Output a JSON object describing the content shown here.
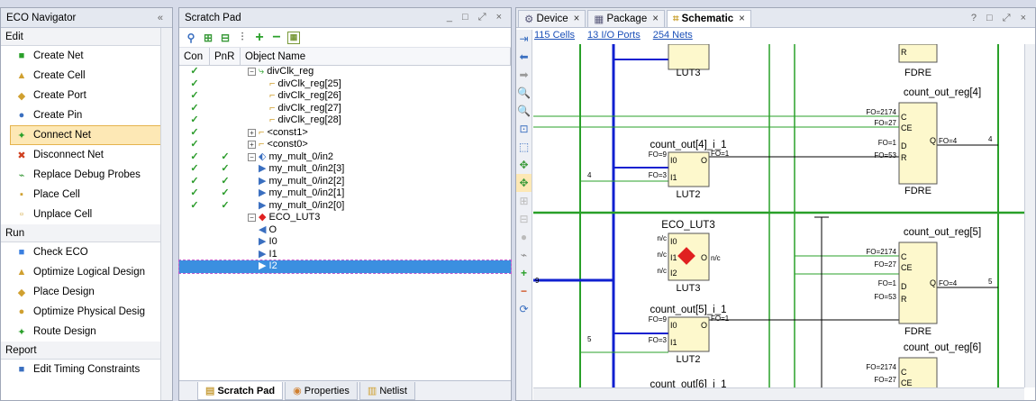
{
  "eco": {
    "title": "ECO Navigator",
    "collapse": "«",
    "sections": {
      "edit": "Edit",
      "run": "Run",
      "report": "Report"
    },
    "edit_items": [
      "Create Net",
      "Create Cell",
      "Create Port",
      "Create Pin",
      "Connect Net",
      "Disconnect Net",
      "Replace Debug Probes",
      "Place Cell",
      "Unplace Cell"
    ],
    "run_items": [
      "Check ECO",
      "Optimize Logical Design",
      "Place Design",
      "Optimize Physical Desig",
      "Route Design"
    ],
    "report_items": [
      "Edit Timing Constraints"
    ]
  },
  "scratchpad": {
    "title": "Scratch Pad",
    "controls": "_ □ ⤢ ×",
    "headers": {
      "con": "Con",
      "pnr": "PnR",
      "name": "Object Name"
    },
    "rows": [
      {
        "con": "✓",
        "pnr": "",
        "name": "divClk_reg",
        "indent": 0,
        "exp": "−",
        "icon": "cell"
      },
      {
        "con": "✓",
        "pnr": "",
        "name": "divClk_reg[25]",
        "indent": 2,
        "exp": "",
        "icon": "pin"
      },
      {
        "con": "✓",
        "pnr": "",
        "name": "divClk_reg[26]",
        "indent": 2,
        "exp": "",
        "icon": "pin"
      },
      {
        "con": "✓",
        "pnr": "",
        "name": "divClk_reg[27]",
        "indent": 2,
        "exp": "",
        "icon": "pin"
      },
      {
        "con": "✓",
        "pnr": "",
        "name": "divClk_reg[28]",
        "indent": 2,
        "exp": "",
        "icon": "pin"
      },
      {
        "con": "✓",
        "pnr": "",
        "name": "<const1>",
        "indent": 0,
        "exp": "+",
        "icon": "pin"
      },
      {
        "con": "✓",
        "pnr": "",
        "name": "<const0>",
        "indent": 0,
        "exp": "+",
        "icon": "pin"
      },
      {
        "con": "✓",
        "pnr": "✓",
        "name": "my_mult_0/in2",
        "indent": 0,
        "exp": "−",
        "icon": "bus"
      },
      {
        "con": "✓",
        "pnr": "✓",
        "name": "my_mult_0/in2[3]",
        "indent": 1,
        "exp": "",
        "icon": "port"
      },
      {
        "con": "✓",
        "pnr": "✓",
        "name": "my_mult_0/in2[2]",
        "indent": 1,
        "exp": "",
        "icon": "port"
      },
      {
        "con": "✓",
        "pnr": "✓",
        "name": "my_mult_0/in2[1]",
        "indent": 1,
        "exp": "",
        "icon": "port"
      },
      {
        "con": "✓",
        "pnr": "✓",
        "name": "my_mult_0/in2[0]",
        "indent": 1,
        "exp": "",
        "icon": "port"
      },
      {
        "con": "",
        "pnr": "",
        "name": "ECO_LUT3",
        "indent": 0,
        "exp": "−",
        "icon": "diamond"
      },
      {
        "con": "",
        "pnr": "",
        "name": "O",
        "indent": 1,
        "exp": "",
        "icon": "outport"
      },
      {
        "con": "",
        "pnr": "",
        "name": "I0",
        "indent": 1,
        "exp": "",
        "icon": "port"
      },
      {
        "con": "",
        "pnr": "",
        "name": "I1",
        "indent": 1,
        "exp": "",
        "icon": "port"
      },
      {
        "con": "",
        "pnr": "",
        "name": "I2",
        "indent": 1,
        "exp": "",
        "icon": "port",
        "selected": true
      }
    ],
    "tabs": [
      "Scratch Pad",
      "Properties",
      "Netlist"
    ]
  },
  "schematic": {
    "tabs": [
      "Device",
      "Package",
      "Schematic"
    ],
    "controls": "? □ ⤢ ×",
    "stats": [
      "115 Cells",
      "13 I/O Ports",
      "254 Nets"
    ],
    "labels": {
      "lut3_top": "LUT3",
      "fdre": "FDRE",
      "reg4": "count_out_reg[4]",
      "reg5": "count_out_reg[5]",
      "reg6": "count_out_reg[6]",
      "i1_4": "count_out[4]_i_1",
      "i1_5": "count_out[5]_i_1",
      "i1_6": "count_out[6]_i_1",
      "lut2": "LUT2",
      "eco": "ECO_LUT3",
      "fo2174": "FO=2174",
      "fo27": "FO=27",
      "fo1": "FO=1",
      "fo53": "FO=53",
      "fo4": "FO=4",
      "fo9": "FO=9",
      "fo3": "FO=3",
      "nc": "n/c",
      "four": "4",
      "five": "5",
      "nine": "9",
      "pC": "C",
      "pCE": "CE",
      "pD": "D",
      "pR": "R",
      "pQ": "Q",
      "pO": "O",
      "pI0": "I0",
      "pI1": "I1",
      "pI2": "I2"
    }
  }
}
